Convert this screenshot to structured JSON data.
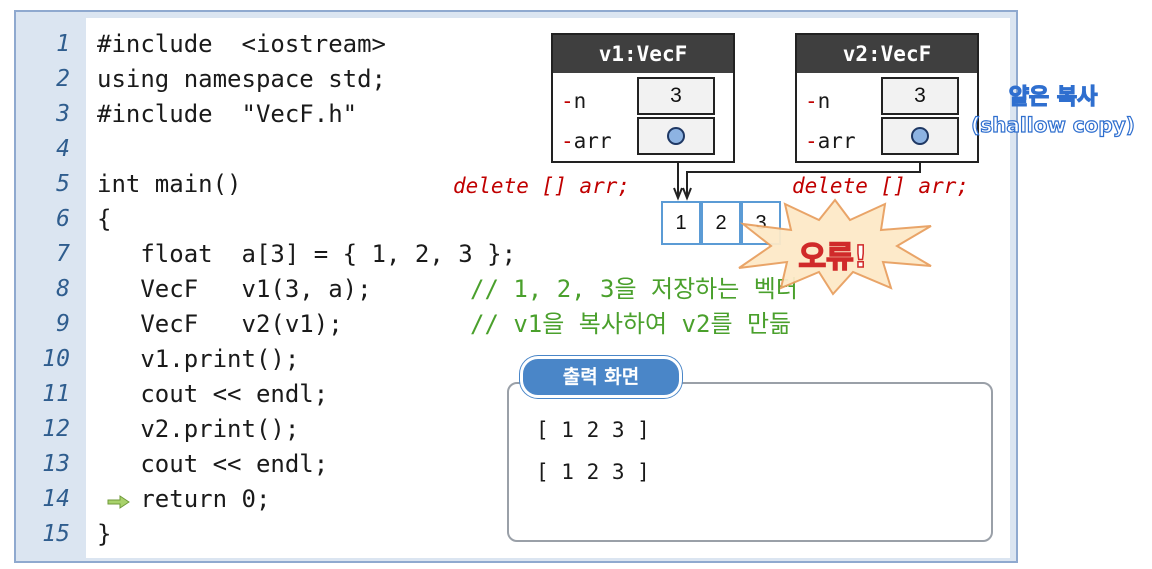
{
  "line_numbers": [
    "1",
    "2",
    "3",
    "4",
    "5",
    "6",
    "7",
    "8",
    "9",
    "10",
    "11",
    "12",
    "13",
    "14",
    "15"
  ],
  "code_lines": [
    "#include  <iostream>",
    "using namespace std;",
    "#include  \"VecF.h\"",
    "",
    "int main()",
    "{",
    "   float  a[3] = { 1, 2, 3 };",
    "   VecF   v1(3, a);",
    "   VecF   v2(v1);",
    "   v1.print();",
    "   cout << endl;",
    "   v2.print();",
    "   cout << endl;",
    "   return 0;",
    "}"
  ],
  "comments": {
    "line8": "// 1, 2, 3을 저장하는 벡터",
    "line9": "// v1을 복사하여 v2를 만듦"
  },
  "objects": {
    "v1": {
      "title": "v1:VecF",
      "field_n": "n",
      "field_arr": "arr",
      "n_value": "3"
    },
    "v2": {
      "title": "v2:VecF",
      "field_n": "n",
      "field_arr": "arr",
      "n_value": "3"
    }
  },
  "field_dash": "-",
  "delete_label": "delete [] arr;",
  "array_values": [
    "1",
    "2",
    "3"
  ],
  "shallow_copy": {
    "line1": "얕은 복사",
    "line2": "(shallow copy)"
  },
  "error_label": "오류!",
  "output": {
    "title": "출력 화면",
    "lines": [
      "[ 1 2 3 ]",
      "[ 1 2 3 ]"
    ]
  },
  "colors": {
    "keyword_text": "#1a1a1a",
    "comment": "#4aa02c",
    "line_number": "#2f5d8e",
    "delete_text": "#c00000",
    "accent": "#4a86c8"
  }
}
